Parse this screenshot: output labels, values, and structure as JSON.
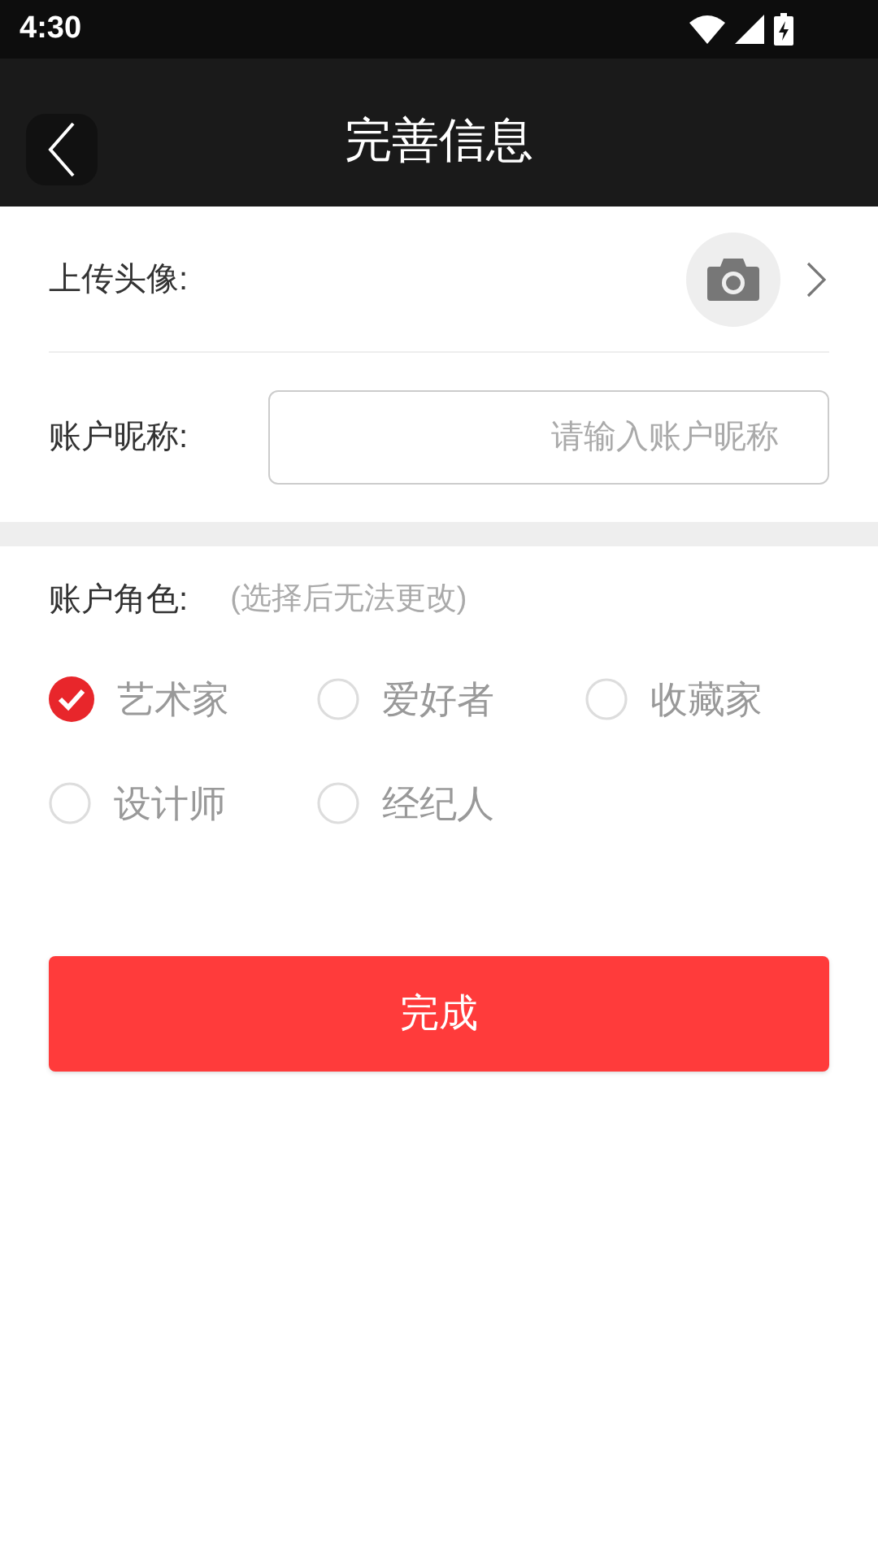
{
  "status_bar": {
    "time": "4:30"
  },
  "header": {
    "title": "完善信息"
  },
  "avatar": {
    "label": "上传头像:"
  },
  "nickname": {
    "label": "账户昵称:",
    "placeholder": "请输入账户昵称"
  },
  "role": {
    "label": "账户角色:",
    "note": "(选择后无法更改)",
    "options": [
      {
        "label": "艺术家",
        "selected": true
      },
      {
        "label": "爱好者",
        "selected": false
      },
      {
        "label": "收藏家",
        "selected": false
      },
      {
        "label": "设计师",
        "selected": false
      },
      {
        "label": "经纪人",
        "selected": false
      }
    ]
  },
  "submit_button": "完成"
}
